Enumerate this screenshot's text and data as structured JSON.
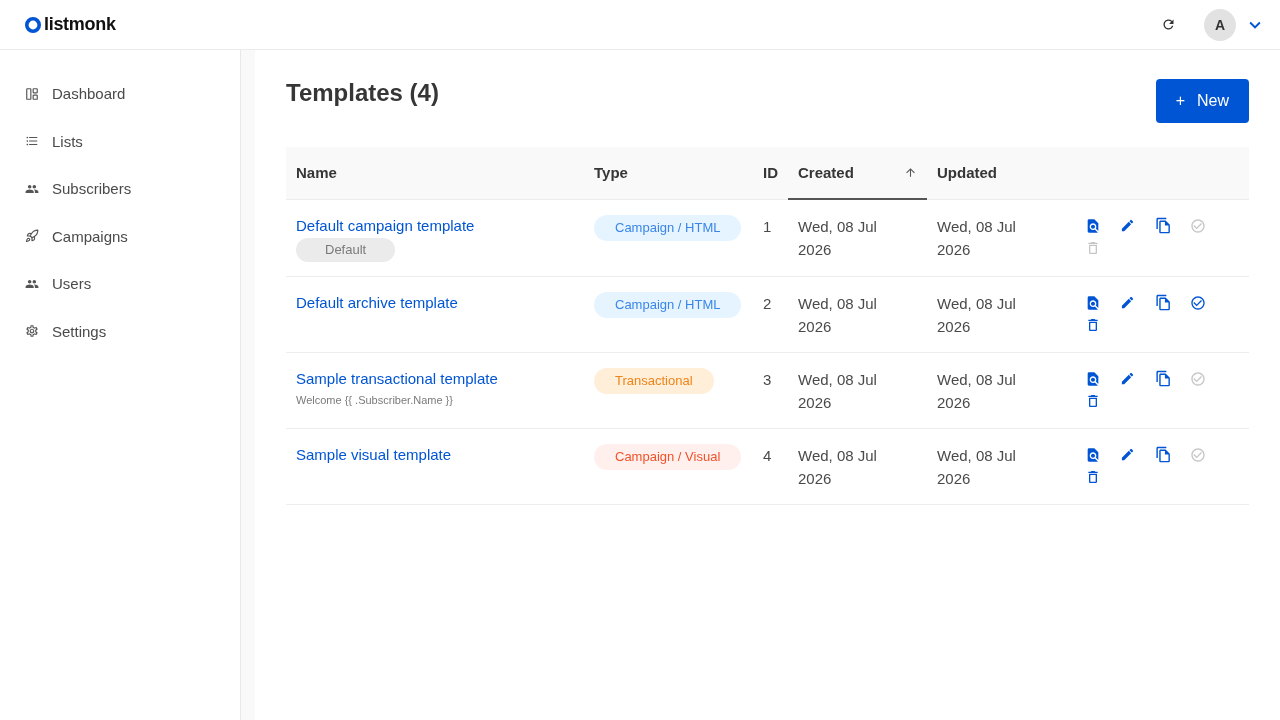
{
  "header": {
    "logo": "listmonk",
    "avatar": "A"
  },
  "sidebar": {
    "items": [
      {
        "label": "Dashboard",
        "kind": "dashboard"
      },
      {
        "label": "Lists",
        "kind": "lists"
      },
      {
        "label": "Subscribers",
        "kind": "subscribers"
      },
      {
        "label": "Campaigns",
        "kind": "campaigns"
      },
      {
        "label": "Users",
        "kind": "users"
      },
      {
        "label": "Settings",
        "kind": "settings"
      }
    ]
  },
  "page": {
    "title": "Templates (4)",
    "new_button": {
      "icon": "+",
      "label": "New"
    }
  },
  "table": {
    "columns": [
      {
        "label": "Name",
        "sorted": false
      },
      {
        "label": "Type",
        "sorted": false
      },
      {
        "label": "ID",
        "sorted": false
      },
      {
        "label": "Created",
        "sorted": true
      },
      {
        "label": "Updated",
        "sorted": false
      }
    ],
    "rows": [
      {
        "name": "Default campaign template",
        "badge": "Default",
        "type": {
          "label": "Campaign / HTML",
          "kind": "html"
        },
        "id": "1",
        "created": "Wed, 08 Jul 2026",
        "updated": "Wed, 08 Jul 2026",
        "set_default_disabled": true,
        "delete_disabled": true
      },
      {
        "name": "Default archive template",
        "type": {
          "label": "Campaign / HTML",
          "kind": "html"
        },
        "id": "2",
        "created": "Wed, 08 Jul 2026",
        "updated": "Wed, 08 Jul 2026",
        "set_default_disabled": false,
        "delete_disabled": false
      },
      {
        "name": "Sample transactional template",
        "subject": "Welcome {{ .Subscriber.Name }}",
        "type": {
          "label": "Transactional",
          "kind": "transactional"
        },
        "id": "3",
        "created": "Wed, 08 Jul 2026",
        "updated": "Wed, 08 Jul 2026",
        "set_default_disabled": true,
        "delete_disabled": false
      },
      {
        "name": "Sample visual template",
        "type": {
          "label": "Campaign / Visual",
          "kind": "visual"
        },
        "id": "4",
        "created": "Wed, 08 Jul 2026",
        "updated": "Wed, 08 Jul 2026",
        "set_default_disabled": true,
        "delete_disabled": false
      }
    ]
  }
}
